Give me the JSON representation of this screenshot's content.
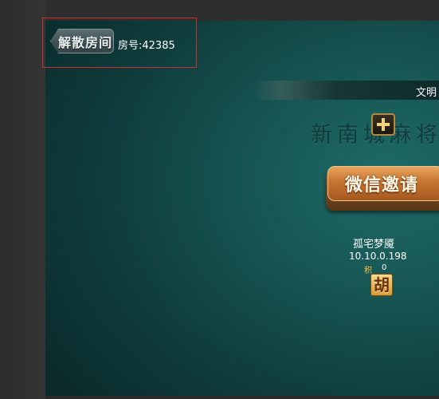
{
  "toolbar": {
    "dissolve_room_label": "解散房间",
    "room_number_text": "房号:42385"
  },
  "banner": {
    "text": "文明"
  },
  "table": {
    "title_text": "新南城麻将",
    "plus_icon": "plus-icon"
  },
  "invite": {
    "label": "微信邀请"
  },
  "player": {
    "name": "孤宅梦魇",
    "ip": "10.10.0.198",
    "score_label": "积",
    "score_value": "0",
    "tile_char": "胡"
  },
  "colors": {
    "highlight_border": "#c9302c",
    "felt": "#165552",
    "score_label": "#f5c542"
  }
}
